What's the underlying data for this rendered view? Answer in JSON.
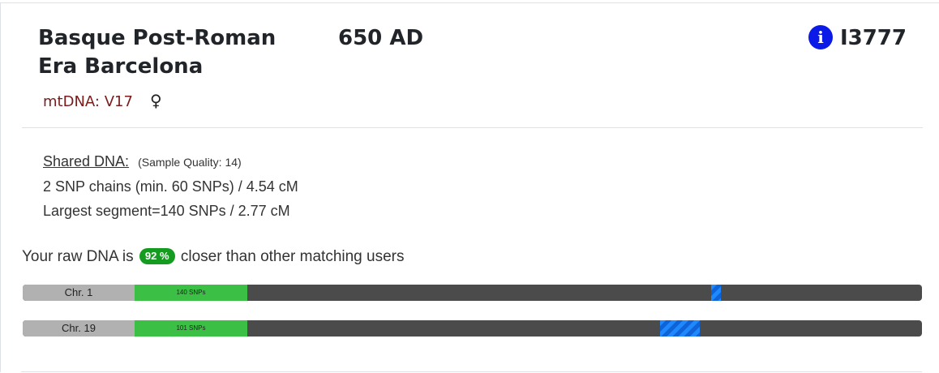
{
  "sample": {
    "culture": "Basque Post-Roman Era Barcelona",
    "date": "650 AD",
    "id": "I3777",
    "info_icon": "info-icon",
    "mtdna": "mtDNA: V17",
    "sex_icon": "♀"
  },
  "shared": {
    "label": "Shared DNA:",
    "quality": "(Sample Quality: 14)",
    "chains": "2 SNP chains (min. 60 SNPs) / 4.54 cM",
    "largest": "Largest segment=140 SNPs / 2.77 cM"
  },
  "raw": {
    "prefix": "Your raw DNA is",
    "percent": "92 %",
    "suffix": "closer than other matching users"
  },
  "chromosomes": [
    {
      "label": "Chr. 1",
      "snps": "140 SNPs",
      "segment_start": 0.7652,
      "segment_end": 0.776
    },
    {
      "label": "Chr. 19",
      "snps": "101 SNPs",
      "segment_start": 0.7087,
      "segment_end": 0.753
    }
  ],
  "colors": {
    "info_icon": "#0b1ae6",
    "badge": "#169b21",
    "snp_fill": "#3bbf44",
    "segment": "#1e88ff",
    "track": "#4b4b4b",
    "mtdna": "#7a1c1c"
  }
}
